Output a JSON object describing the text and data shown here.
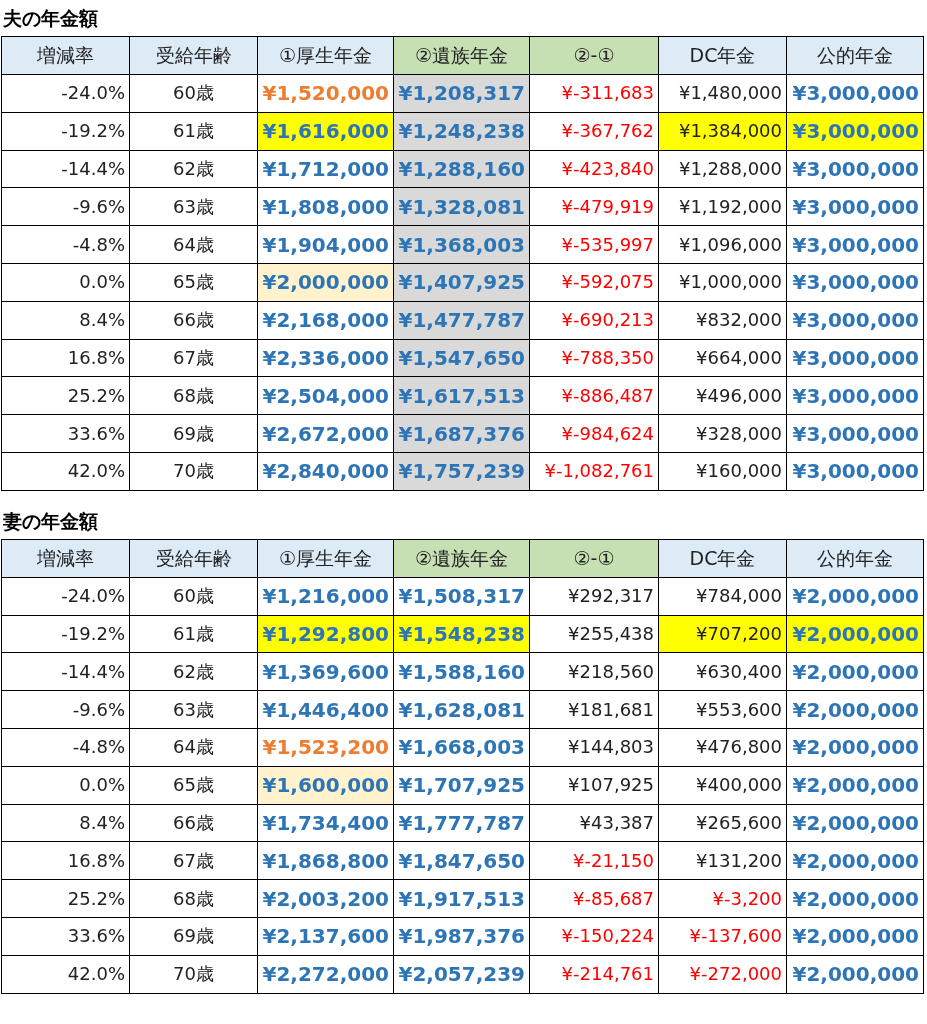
{
  "tables": [
    {
      "title": "夫の年金額",
      "columns": [
        {
          "label": "増減率",
          "color": "#ddebf7"
        },
        {
          "label": "受給年齢",
          "color": "#ddebf7"
        },
        {
          "label": "①厚生年金",
          "color": "#ddebf7"
        },
        {
          "label": "②遺族年金",
          "color": "#c6e0b4"
        },
        {
          "label": "②-①",
          "color": "#c6e0b4"
        },
        {
          "label": "DC年金",
          "color": "#ddebf7"
        },
        {
          "label": "公的年金",
          "color": "#ddebf7"
        }
      ],
      "rows": [
        {
          "cells": [
            {
              "text": "-24.0%",
              "kind": "plain"
            },
            {
              "text": "60歳",
              "kind": "plain"
            },
            {
              "text": "¥1,520,000",
              "kind": "orange"
            },
            {
              "text": "¥1,208,317",
              "kind": "blue",
              "color": "#d9d9d9"
            },
            {
              "text": "¥-311,683",
              "kind": "red"
            },
            {
              "text": "¥1,480,000",
              "kind": "plain"
            },
            {
              "text": "¥3,000,000",
              "kind": "blue"
            }
          ]
        },
        {
          "cells": [
            {
              "text": "-19.2%",
              "kind": "plain"
            },
            {
              "text": "61歳",
              "kind": "plain"
            },
            {
              "text": "¥1,616,000",
              "kind": "blue",
              "color": "#ffff00"
            },
            {
              "text": "¥1,248,238",
              "kind": "blue",
              "color": "#d9d9d9"
            },
            {
              "text": "¥-367,762",
              "kind": "red"
            },
            {
              "text": "¥1,384,000",
              "kind": "plain",
              "color": "#ffff00"
            },
            {
              "text": "¥3,000,000",
              "kind": "blue",
              "color": "#ffff00"
            }
          ]
        },
        {
          "cells": [
            {
              "text": "-14.4%",
              "kind": "plain"
            },
            {
              "text": "62歳",
              "kind": "plain"
            },
            {
              "text": "¥1,712,000",
              "kind": "blue"
            },
            {
              "text": "¥1,288,160",
              "kind": "blue",
              "color": "#d9d9d9"
            },
            {
              "text": "¥-423,840",
              "kind": "red"
            },
            {
              "text": "¥1,288,000",
              "kind": "plain"
            },
            {
              "text": "¥3,000,000",
              "kind": "blue"
            }
          ]
        },
        {
          "cells": [
            {
              "text": "-9.6%",
              "kind": "plain"
            },
            {
              "text": "63歳",
              "kind": "plain"
            },
            {
              "text": "¥1,808,000",
              "kind": "blue"
            },
            {
              "text": "¥1,328,081",
              "kind": "blue",
              "color": "#d9d9d9"
            },
            {
              "text": "¥-479,919",
              "kind": "red"
            },
            {
              "text": "¥1,192,000",
              "kind": "plain"
            },
            {
              "text": "¥3,000,000",
              "kind": "blue"
            }
          ]
        },
        {
          "cells": [
            {
              "text": "-4.8%",
              "kind": "plain"
            },
            {
              "text": "64歳",
              "kind": "plain"
            },
            {
              "text": "¥1,904,000",
              "kind": "blue"
            },
            {
              "text": "¥1,368,003",
              "kind": "blue",
              "color": "#d9d9d9"
            },
            {
              "text": "¥-535,997",
              "kind": "red"
            },
            {
              "text": "¥1,096,000",
              "kind": "plain"
            },
            {
              "text": "¥3,000,000",
              "kind": "blue"
            }
          ]
        },
        {
          "cells": [
            {
              "text": "0.0%",
              "kind": "plain"
            },
            {
              "text": "65歳",
              "kind": "plain"
            },
            {
              "text": "¥2,000,000",
              "kind": "blue",
              "color": "#fff2cc"
            },
            {
              "text": "¥1,407,925",
              "kind": "blue",
              "color": "#d9d9d9"
            },
            {
              "text": "¥-592,075",
              "kind": "red"
            },
            {
              "text": "¥1,000,000",
              "kind": "plain"
            },
            {
              "text": "¥3,000,000",
              "kind": "blue"
            }
          ]
        },
        {
          "cells": [
            {
              "text": "8.4%",
              "kind": "plain"
            },
            {
              "text": "66歳",
              "kind": "plain"
            },
            {
              "text": "¥2,168,000",
              "kind": "blue"
            },
            {
              "text": "¥1,477,787",
              "kind": "blue",
              "color": "#d9d9d9"
            },
            {
              "text": "¥-690,213",
              "kind": "red"
            },
            {
              "text": "¥832,000",
              "kind": "plain"
            },
            {
              "text": "¥3,000,000",
              "kind": "blue"
            }
          ]
        },
        {
          "cells": [
            {
              "text": "16.8%",
              "kind": "plain"
            },
            {
              "text": "67歳",
              "kind": "plain"
            },
            {
              "text": "¥2,336,000",
              "kind": "blue"
            },
            {
              "text": "¥1,547,650",
              "kind": "blue",
              "color": "#d9d9d9"
            },
            {
              "text": "¥-788,350",
              "kind": "red"
            },
            {
              "text": "¥664,000",
              "kind": "plain"
            },
            {
              "text": "¥3,000,000",
              "kind": "blue"
            }
          ]
        },
        {
          "cells": [
            {
              "text": "25.2%",
              "kind": "plain"
            },
            {
              "text": "68歳",
              "kind": "plain"
            },
            {
              "text": "¥2,504,000",
              "kind": "blue"
            },
            {
              "text": "¥1,617,513",
              "kind": "blue",
              "color": "#d9d9d9"
            },
            {
              "text": "¥-886,487",
              "kind": "red"
            },
            {
              "text": "¥496,000",
              "kind": "plain"
            },
            {
              "text": "¥3,000,000",
              "kind": "blue"
            }
          ]
        },
        {
          "cells": [
            {
              "text": "33.6%",
              "kind": "plain"
            },
            {
              "text": "69歳",
              "kind": "plain"
            },
            {
              "text": "¥2,672,000",
              "kind": "blue"
            },
            {
              "text": "¥1,687,376",
              "kind": "blue",
              "color": "#d9d9d9"
            },
            {
              "text": "¥-984,624",
              "kind": "red"
            },
            {
              "text": "¥328,000",
              "kind": "plain"
            },
            {
              "text": "¥3,000,000",
              "kind": "blue"
            }
          ]
        },
        {
          "cells": [
            {
              "text": "42.0%",
              "kind": "plain"
            },
            {
              "text": "70歳",
              "kind": "plain"
            },
            {
              "text": "¥2,840,000",
              "kind": "blue"
            },
            {
              "text": "¥1,757,239",
              "kind": "blue",
              "color": "#d9d9d9"
            },
            {
              "text": "¥-1,082,761",
              "kind": "red"
            },
            {
              "text": "¥160,000",
              "kind": "plain"
            },
            {
              "text": "¥3,000,000",
              "kind": "blue"
            }
          ]
        }
      ]
    },
    {
      "title": "妻の年金額",
      "columns": [
        {
          "label": "増減率",
          "color": "#ddebf7"
        },
        {
          "label": "受給年齢",
          "color": "#ddebf7"
        },
        {
          "label": "①厚生年金",
          "color": "#ddebf7"
        },
        {
          "label": "②遺族年金",
          "color": "#c6e0b4"
        },
        {
          "label": "②-①",
          "color": "#c6e0b4"
        },
        {
          "label": "DC年金",
          "color": "#ddebf7"
        },
        {
          "label": "公的年金",
          "color": "#ddebf7"
        }
      ],
      "rows": [
        {
          "cells": [
            {
              "text": "-24.0%",
              "kind": "plain"
            },
            {
              "text": "60歳",
              "kind": "plain"
            },
            {
              "text": "¥1,216,000",
              "kind": "blue"
            },
            {
              "text": "¥1,508,317",
              "kind": "blue"
            },
            {
              "text": "¥292,317",
              "kind": "plain"
            },
            {
              "text": "¥784,000",
              "kind": "plain"
            },
            {
              "text": "¥2,000,000",
              "kind": "blue"
            }
          ]
        },
        {
          "cells": [
            {
              "text": "-19.2%",
              "kind": "plain"
            },
            {
              "text": "61歳",
              "kind": "plain"
            },
            {
              "text": "¥1,292,800",
              "kind": "blue",
              "color": "#ffff00"
            },
            {
              "text": "¥1,548,238",
              "kind": "blue",
              "color": "#ffff00"
            },
            {
              "text": "¥255,438",
              "kind": "plain"
            },
            {
              "text": "¥707,200",
              "kind": "plain",
              "color": "#ffff00"
            },
            {
              "text": "¥2,000,000",
              "kind": "blue",
              "color": "#ffff00"
            }
          ]
        },
        {
          "cells": [
            {
              "text": "-14.4%",
              "kind": "plain"
            },
            {
              "text": "62歳",
              "kind": "plain"
            },
            {
              "text": "¥1,369,600",
              "kind": "blue"
            },
            {
              "text": "¥1,588,160",
              "kind": "blue"
            },
            {
              "text": "¥218,560",
              "kind": "plain"
            },
            {
              "text": "¥630,400",
              "kind": "plain"
            },
            {
              "text": "¥2,000,000",
              "kind": "blue"
            }
          ]
        },
        {
          "cells": [
            {
              "text": "-9.6%",
              "kind": "plain"
            },
            {
              "text": "63歳",
              "kind": "plain"
            },
            {
              "text": "¥1,446,400",
              "kind": "blue"
            },
            {
              "text": "¥1,628,081",
              "kind": "blue"
            },
            {
              "text": "¥181,681",
              "kind": "plain"
            },
            {
              "text": "¥553,600",
              "kind": "plain"
            },
            {
              "text": "¥2,000,000",
              "kind": "blue"
            }
          ]
        },
        {
          "cells": [
            {
              "text": "-4.8%",
              "kind": "plain"
            },
            {
              "text": "64歳",
              "kind": "plain"
            },
            {
              "text": "¥1,523,200",
              "kind": "orange"
            },
            {
              "text": "¥1,668,003",
              "kind": "blue"
            },
            {
              "text": "¥144,803",
              "kind": "plain"
            },
            {
              "text": "¥476,800",
              "kind": "plain"
            },
            {
              "text": "¥2,000,000",
              "kind": "blue"
            }
          ]
        },
        {
          "cells": [
            {
              "text": "0.0%",
              "kind": "plain"
            },
            {
              "text": "65歳",
              "kind": "plain"
            },
            {
              "text": "¥1,600,000",
              "kind": "blue",
              "color": "#fff2cc"
            },
            {
              "text": "¥1,707,925",
              "kind": "blue"
            },
            {
              "text": "¥107,925",
              "kind": "plain"
            },
            {
              "text": "¥400,000",
              "kind": "plain"
            },
            {
              "text": "¥2,000,000",
              "kind": "blue"
            }
          ]
        },
        {
          "cells": [
            {
              "text": "8.4%",
              "kind": "plain"
            },
            {
              "text": "66歳",
              "kind": "plain"
            },
            {
              "text": "¥1,734,400",
              "kind": "blue"
            },
            {
              "text": "¥1,777,787",
              "kind": "blue"
            },
            {
              "text": "¥43,387",
              "kind": "plain"
            },
            {
              "text": "¥265,600",
              "kind": "plain"
            },
            {
              "text": "¥2,000,000",
              "kind": "blue"
            }
          ]
        },
        {
          "cells": [
            {
              "text": "16.8%",
              "kind": "plain"
            },
            {
              "text": "67歳",
              "kind": "plain"
            },
            {
              "text": "¥1,868,800",
              "kind": "blue"
            },
            {
              "text": "¥1,847,650",
              "kind": "blue"
            },
            {
              "text": "¥-21,150",
              "kind": "red"
            },
            {
              "text": "¥131,200",
              "kind": "plain"
            },
            {
              "text": "¥2,000,000",
              "kind": "blue"
            }
          ]
        },
        {
          "cells": [
            {
              "text": "25.2%",
              "kind": "plain"
            },
            {
              "text": "68歳",
              "kind": "plain"
            },
            {
              "text": "¥2,003,200",
              "kind": "blue"
            },
            {
              "text": "¥1,917,513",
              "kind": "blue"
            },
            {
              "text": "¥-85,687",
              "kind": "red"
            },
            {
              "text": "¥-3,200",
              "kind": "red"
            },
            {
              "text": "¥2,000,000",
              "kind": "blue"
            }
          ]
        },
        {
          "cells": [
            {
              "text": "33.6%",
              "kind": "plain"
            },
            {
              "text": "69歳",
              "kind": "plain"
            },
            {
              "text": "¥2,137,600",
              "kind": "blue"
            },
            {
              "text": "¥1,987,376",
              "kind": "blue"
            },
            {
              "text": "¥-150,224",
              "kind": "red"
            },
            {
              "text": "¥-137,600",
              "kind": "red"
            },
            {
              "text": "¥2,000,000",
              "kind": "blue"
            }
          ]
        },
        {
          "cells": [
            {
              "text": "42.0%",
              "kind": "plain"
            },
            {
              "text": "70歳",
              "kind": "plain"
            },
            {
              "text": "¥2,272,000",
              "kind": "blue"
            },
            {
              "text": "¥2,057,239",
              "kind": "blue"
            },
            {
              "text": "¥-214,761",
              "kind": "red"
            },
            {
              "text": "¥-272,000",
              "kind": "red"
            },
            {
              "text": "¥2,000,000",
              "kind": "blue"
            }
          ]
        }
      ]
    }
  ]
}
